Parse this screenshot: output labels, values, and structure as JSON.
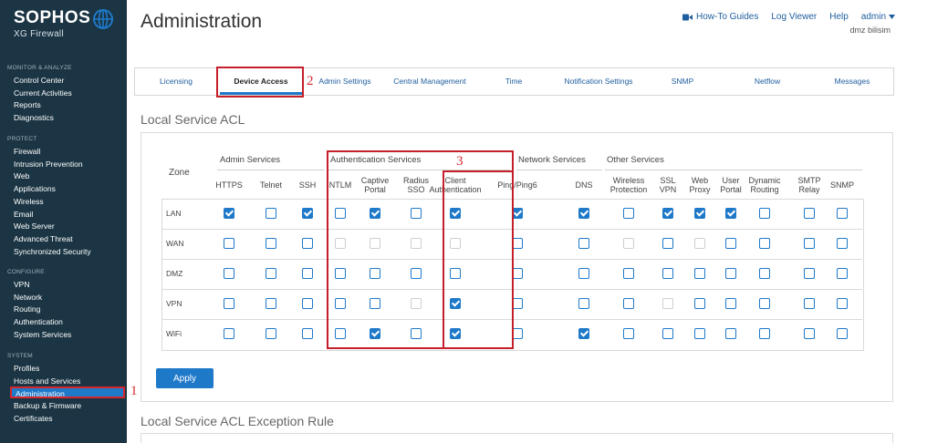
{
  "sidebar": {
    "logo": "SOPHOS",
    "product": "XG Firewall",
    "sections": [
      {
        "title": "MONITOR & ANALYZE",
        "items": [
          "Control Center",
          "Current Activities",
          "Reports",
          "Diagnostics"
        ]
      },
      {
        "title": "PROTECT",
        "items": [
          "Firewall",
          "Intrusion Prevention",
          "Web",
          "Applications",
          "Wireless",
          "Email",
          "Web Server",
          "Advanced Threat",
          "Synchronized Security"
        ]
      },
      {
        "title": "CONFIGURE",
        "items": [
          "VPN",
          "Network",
          "Routing",
          "Authentication",
          "System Services"
        ]
      },
      {
        "title": "SYSTEM",
        "items": [
          "Profiles",
          "Hosts and Services",
          "Administration",
          "Backup & Firmware",
          "Certificates"
        ]
      }
    ],
    "active_item": "Administration"
  },
  "header": {
    "title": "Administration",
    "links": {
      "howto": "How-To Guides",
      "logviewer": "Log Viewer",
      "help": "Help",
      "user": "admin"
    },
    "org": "dmz bilisim"
  },
  "tabs": [
    "Licensing",
    "Device Access",
    "Admin Settings",
    "Central Management",
    "Time",
    "Notification Settings",
    "SNMP",
    "Netflow",
    "Messages"
  ],
  "active_tab": "Device Access",
  "annotations": {
    "a1": "1",
    "a2": "2",
    "a3": "3"
  },
  "acl": {
    "title": "Local Service ACL",
    "zone_header": "Zone",
    "groups": [
      "Admin Services",
      "Authentication Services",
      "Network Services",
      "Other Services"
    ],
    "columns": [
      "HTTPS",
      "Telnet",
      "SSH",
      "NTLM",
      "Captive Portal",
      "Radius SSO",
      "Client Authentication",
      "Ping/Ping6",
      "DNS",
      "Wireless Protection",
      "SSL VPN",
      "Web Proxy",
      "User Portal",
      "Dynamic Routing",
      "SMTP Relay",
      "SNMP"
    ],
    "column_lines": [
      [
        "HTTPS"
      ],
      [
        "Telnet"
      ],
      [
        "SSH"
      ],
      [
        "NTLM"
      ],
      [
        "Captive",
        "Portal"
      ],
      [
        "Radius",
        "SSO"
      ],
      [
        "Client",
        "Authentication"
      ],
      [
        "Ping/Ping6"
      ],
      [
        "DNS"
      ],
      [
        "Wireless",
        "Protection"
      ],
      [
        "SSL",
        "VPN"
      ],
      [
        "Web",
        "Proxy"
      ],
      [
        "User",
        "Portal"
      ],
      [
        "Dynamic",
        "Routing"
      ],
      [
        "SMTP",
        "Relay"
      ],
      [
        "SNMP"
      ]
    ],
    "rows": [
      {
        "zone": "LAN",
        "states": [
          "checked",
          "unchecked",
          "checked",
          "unchecked",
          "checked",
          "unchecked",
          "checked",
          "checked",
          "checked",
          "unchecked",
          "checked",
          "checked",
          "checked",
          "unchecked",
          "unchecked",
          "unchecked"
        ]
      },
      {
        "zone": "WAN",
        "states": [
          "unchecked",
          "unchecked",
          "unchecked",
          "disabled",
          "disabled",
          "disabled",
          "disabled",
          "unchecked",
          "unchecked",
          "disabled",
          "unchecked",
          "disabled",
          "unchecked",
          "unchecked",
          "unchecked",
          "unchecked"
        ]
      },
      {
        "zone": "DMZ",
        "states": [
          "unchecked",
          "unchecked",
          "unchecked",
          "unchecked",
          "unchecked",
          "unchecked",
          "unchecked",
          "unchecked",
          "unchecked",
          "unchecked",
          "unchecked",
          "unchecked",
          "unchecked",
          "unchecked",
          "unchecked",
          "unchecked"
        ]
      },
      {
        "zone": "VPN",
        "states": [
          "unchecked",
          "unchecked",
          "unchecked",
          "unchecked",
          "unchecked",
          "disabled",
          "checked",
          "unchecked",
          "unchecked",
          "unchecked",
          "disabled",
          "unchecked",
          "unchecked",
          "unchecked",
          "unchecked",
          "unchecked"
        ]
      },
      {
        "zone": "WiFi",
        "states": [
          "unchecked",
          "unchecked",
          "unchecked",
          "unchecked",
          "checked",
          "unchecked",
          "checked",
          "unchecked",
          "checked",
          "unchecked",
          "unchecked",
          "unchecked",
          "unchecked",
          "unchecked",
          "unchecked",
          "unchecked"
        ]
      }
    ],
    "apply_label": "Apply"
  },
  "exception": {
    "title": "Local Service ACL Exception Rule"
  },
  "colors": {
    "sidebar_bg": "#1b3544",
    "accent": "#1f79c9",
    "annotation_red": "#d7262c"
  }
}
